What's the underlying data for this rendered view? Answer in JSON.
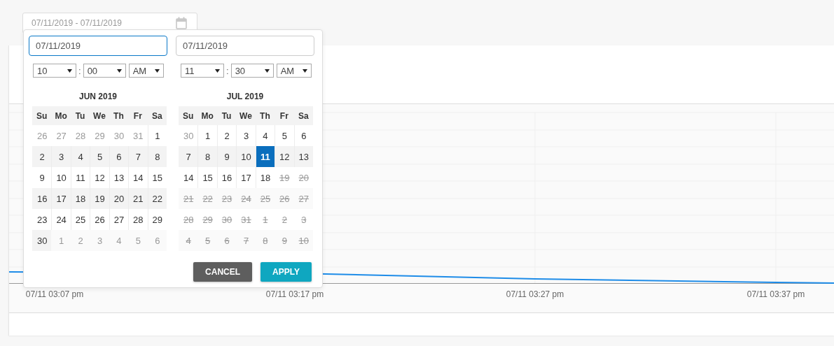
{
  "range_field": {
    "value": "07/11/2019 - 07/11/2019"
  },
  "picker": {
    "start": {
      "value": "07/11/2019",
      "focused": true,
      "hour": "10",
      "separator": ":",
      "minute": "00",
      "ampm": "AM"
    },
    "end": {
      "value": "07/11/2019",
      "focused": false,
      "hour": "11",
      "separator": ":",
      "minute": "30",
      "ampm": "AM"
    },
    "months": [
      {
        "title": "JUN 2019",
        "weekdays": [
          "Su",
          "Mo",
          "Tu",
          "We",
          "Th",
          "Fr",
          "Sa"
        ],
        "weeks": [
          [
            {
              "label": "26",
              "kind": "other",
              "selected": false
            },
            {
              "label": "27",
              "kind": "other",
              "selected": false
            },
            {
              "label": "28",
              "kind": "other",
              "selected": false
            },
            {
              "label": "29",
              "kind": "other",
              "selected": false
            },
            {
              "label": "30",
              "kind": "other",
              "selected": false
            },
            {
              "label": "31",
              "kind": "other",
              "selected": false
            },
            {
              "label": "1",
              "kind": "current",
              "selected": false
            }
          ],
          [
            {
              "label": "2",
              "kind": "current",
              "selected": false
            },
            {
              "label": "3",
              "kind": "current",
              "selected": false
            },
            {
              "label": "4",
              "kind": "current",
              "selected": false
            },
            {
              "label": "5",
              "kind": "current",
              "selected": false
            },
            {
              "label": "6",
              "kind": "current",
              "selected": false
            },
            {
              "label": "7",
              "kind": "current",
              "selected": false
            },
            {
              "label": "8",
              "kind": "current",
              "selected": false
            }
          ],
          [
            {
              "label": "9",
              "kind": "current",
              "selected": false
            },
            {
              "label": "10",
              "kind": "current",
              "selected": false
            },
            {
              "label": "11",
              "kind": "current",
              "selected": false
            },
            {
              "label": "12",
              "kind": "current",
              "selected": false
            },
            {
              "label": "13",
              "kind": "current",
              "selected": false
            },
            {
              "label": "14",
              "kind": "current",
              "selected": false
            },
            {
              "label": "15",
              "kind": "current",
              "selected": false
            }
          ],
          [
            {
              "label": "16",
              "kind": "current",
              "selected": false
            },
            {
              "label": "17",
              "kind": "current",
              "selected": false
            },
            {
              "label": "18",
              "kind": "current",
              "selected": false
            },
            {
              "label": "19",
              "kind": "current",
              "selected": false
            },
            {
              "label": "20",
              "kind": "current",
              "selected": false
            },
            {
              "label": "21",
              "kind": "current",
              "selected": false
            },
            {
              "label": "22",
              "kind": "current",
              "selected": false
            }
          ],
          [
            {
              "label": "23",
              "kind": "current",
              "selected": false
            },
            {
              "label": "24",
              "kind": "current",
              "selected": false
            },
            {
              "label": "25",
              "kind": "current",
              "selected": false
            },
            {
              "label": "26",
              "kind": "current",
              "selected": false
            },
            {
              "label": "27",
              "kind": "current",
              "selected": false
            },
            {
              "label": "28",
              "kind": "current",
              "selected": false
            },
            {
              "label": "29",
              "kind": "current",
              "selected": false
            }
          ],
          [
            {
              "label": "30",
              "kind": "current",
              "selected": false
            },
            {
              "label": "1",
              "kind": "other",
              "selected": false
            },
            {
              "label": "2",
              "kind": "other",
              "selected": false
            },
            {
              "label": "3",
              "kind": "other",
              "selected": false
            },
            {
              "label": "4",
              "kind": "other",
              "selected": false
            },
            {
              "label": "5",
              "kind": "other",
              "selected": false
            },
            {
              "label": "6",
              "kind": "other",
              "selected": false
            }
          ]
        ]
      },
      {
        "title": "JUL 2019",
        "weekdays": [
          "Su",
          "Mo",
          "Tu",
          "We",
          "Th",
          "Fr",
          "Sa"
        ],
        "weeks": [
          [
            {
              "label": "30",
              "kind": "other",
              "selected": false
            },
            {
              "label": "1",
              "kind": "current",
              "selected": false
            },
            {
              "label": "2",
              "kind": "current",
              "selected": false
            },
            {
              "label": "3",
              "kind": "current",
              "selected": false
            },
            {
              "label": "4",
              "kind": "current",
              "selected": false
            },
            {
              "label": "5",
              "kind": "current",
              "selected": false
            },
            {
              "label": "6",
              "kind": "current",
              "selected": false
            }
          ],
          [
            {
              "label": "7",
              "kind": "current",
              "selected": false
            },
            {
              "label": "8",
              "kind": "current",
              "selected": false
            },
            {
              "label": "9",
              "kind": "current",
              "selected": false
            },
            {
              "label": "10",
              "kind": "current",
              "selected": false
            },
            {
              "label": "11",
              "kind": "current",
              "selected": true
            },
            {
              "label": "12",
              "kind": "current",
              "selected": false
            },
            {
              "label": "13",
              "kind": "current",
              "selected": false
            }
          ],
          [
            {
              "label": "14",
              "kind": "current",
              "selected": false
            },
            {
              "label": "15",
              "kind": "current",
              "selected": false
            },
            {
              "label": "16",
              "kind": "current",
              "selected": false
            },
            {
              "label": "17",
              "kind": "current",
              "selected": false
            },
            {
              "label": "18",
              "kind": "current",
              "selected": false
            },
            {
              "label": "19",
              "kind": "disabled",
              "selected": false
            },
            {
              "label": "20",
              "kind": "disabled",
              "selected": false
            }
          ],
          [
            {
              "label": "21",
              "kind": "disabled",
              "selected": false
            },
            {
              "label": "22",
              "kind": "disabled",
              "selected": false
            },
            {
              "label": "23",
              "kind": "disabled",
              "selected": false
            },
            {
              "label": "24",
              "kind": "disabled",
              "selected": false
            },
            {
              "label": "25",
              "kind": "disabled",
              "selected": false
            },
            {
              "label": "26",
              "kind": "disabled",
              "selected": false
            },
            {
              "label": "27",
              "kind": "disabled",
              "selected": false
            }
          ],
          [
            {
              "label": "28",
              "kind": "disabled",
              "selected": false
            },
            {
              "label": "29",
              "kind": "disabled",
              "selected": false
            },
            {
              "label": "30",
              "kind": "disabled",
              "selected": false
            },
            {
              "label": "31",
              "kind": "disabled",
              "selected": false
            },
            {
              "label": "1",
              "kind": "disabled",
              "selected": false
            },
            {
              "label": "2",
              "kind": "disabled",
              "selected": false
            },
            {
              "label": "3",
              "kind": "disabled",
              "selected": false
            }
          ],
          [
            {
              "label": "4",
              "kind": "disabled",
              "selected": false
            },
            {
              "label": "5",
              "kind": "disabled",
              "selected": false
            },
            {
              "label": "6",
              "kind": "disabled",
              "selected": false
            },
            {
              "label": "7",
              "kind": "disabled",
              "selected": false
            },
            {
              "label": "8",
              "kind": "disabled",
              "selected": false
            },
            {
              "label": "9",
              "kind": "disabled",
              "selected": false
            },
            {
              "label": "10",
              "kind": "disabled",
              "selected": false
            }
          ]
        ]
      }
    ],
    "buttons": [
      {
        "label": "CANCEL",
        "kind": "cancel"
      },
      {
        "label": "APPLY",
        "kind": "apply"
      }
    ]
  },
  "chart": {
    "x_labels": [
      "07/11 03:07 pm",
      "07/11 03:17 pm",
      "07/11 03:27 pm",
      "07/11 03:37 pm"
    ]
  }
}
